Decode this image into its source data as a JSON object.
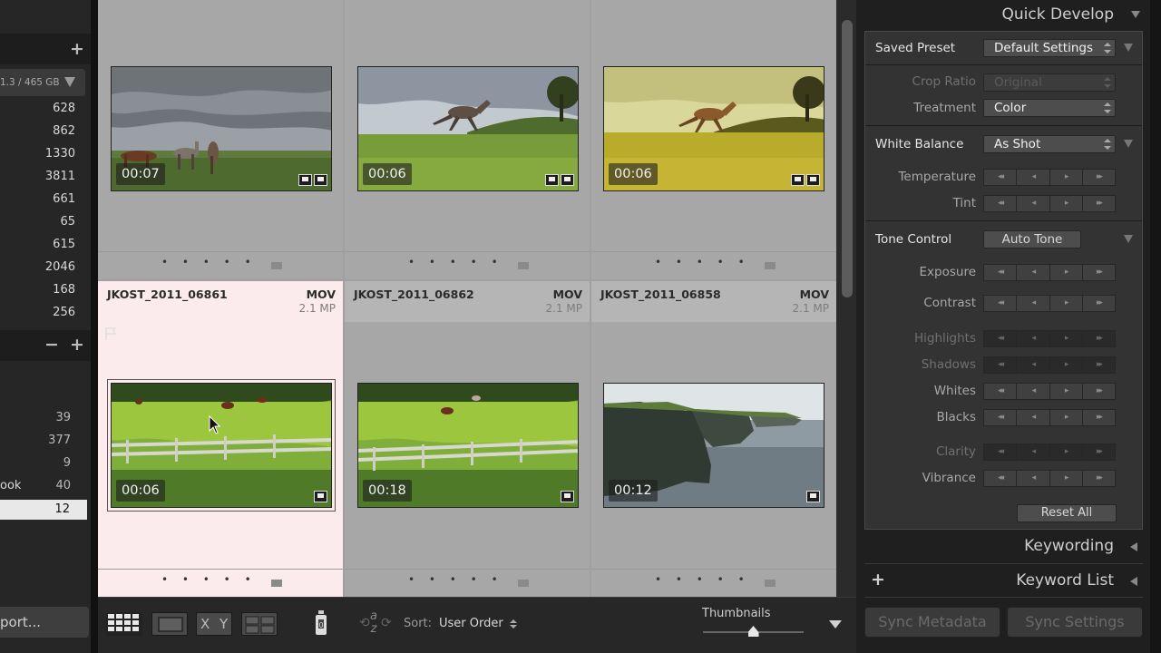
{
  "left_panel": {
    "volume_label": "1.3 / 465 GB",
    "folder_counts": [
      "628",
      "862",
      "1330",
      "3811",
      "661",
      "65",
      "615",
      "2046",
      "168",
      "256"
    ],
    "collection_counts": [
      "39",
      "377",
      "9",
      "40",
      "12"
    ],
    "collection_partial_name": "ook",
    "export_label": "port..."
  },
  "grid": {
    "cells": [
      {
        "name": "",
        "type": "",
        "size": "",
        "duration": "00:07"
      },
      {
        "name": "",
        "type": "",
        "size": "",
        "duration": "00:06"
      },
      {
        "name": "",
        "type": "",
        "size": "",
        "duration": "00:06"
      },
      {
        "name": "JKOST_2011_06861",
        "type": "MOV",
        "size": "2.1 MP",
        "duration": "00:06"
      },
      {
        "name": "JKOST_2011_06862",
        "type": "MOV",
        "size": "2.1 MP",
        "duration": "00:18"
      },
      {
        "name": "JKOST_2011_06858",
        "type": "MOV",
        "size": "2.1 MP",
        "duration": "00:12"
      }
    ],
    "grid_dots": "• • • • •"
  },
  "toolbar": {
    "sort_label": "Sort:",
    "sort_value": "User Order",
    "thumbnails_label": "Thumbnails",
    "xy_label": "X Y",
    "sort_az_label": "a z",
    "spray_badge": "0",
    "thumbnail_size_fraction": 0.5
  },
  "right_panel": {
    "quick_develop_title": "Quick Develop",
    "saved_preset": {
      "label": "Saved Preset",
      "value": "Default Settings"
    },
    "crop_ratio": {
      "label": "Crop Ratio",
      "value": "Original"
    },
    "treatment": {
      "label": "Treatment",
      "value": "Color"
    },
    "white_balance": {
      "label": "White Balance",
      "value": "As Shot"
    },
    "temperature_label": "Temperature",
    "tint_label": "Tint",
    "tone_control": {
      "label": "Tone Control",
      "button": "Auto Tone"
    },
    "exposure_label": "Exposure",
    "contrast_label": "Contrast",
    "highlights_label": "Highlights",
    "shadows_label": "Shadows",
    "whites_label": "Whites",
    "blacks_label": "Blacks",
    "clarity_label": "Clarity",
    "vibrance_label": "Vibrance",
    "reset_all_label": "Reset All",
    "keywording_label": "Keywording",
    "keyword_list_label": "Keyword List",
    "sync_metadata_label": "Sync Metadata",
    "sync_settings_label": "Sync Settings",
    "stepper_glyphs": [
      "◂◂",
      "◂",
      "▸",
      "▸▸"
    ]
  },
  "colors": {
    "grid_bg": "#a7a7a7",
    "selected_cell_bg": "#fcebec",
    "panel_bg": "#333333"
  }
}
